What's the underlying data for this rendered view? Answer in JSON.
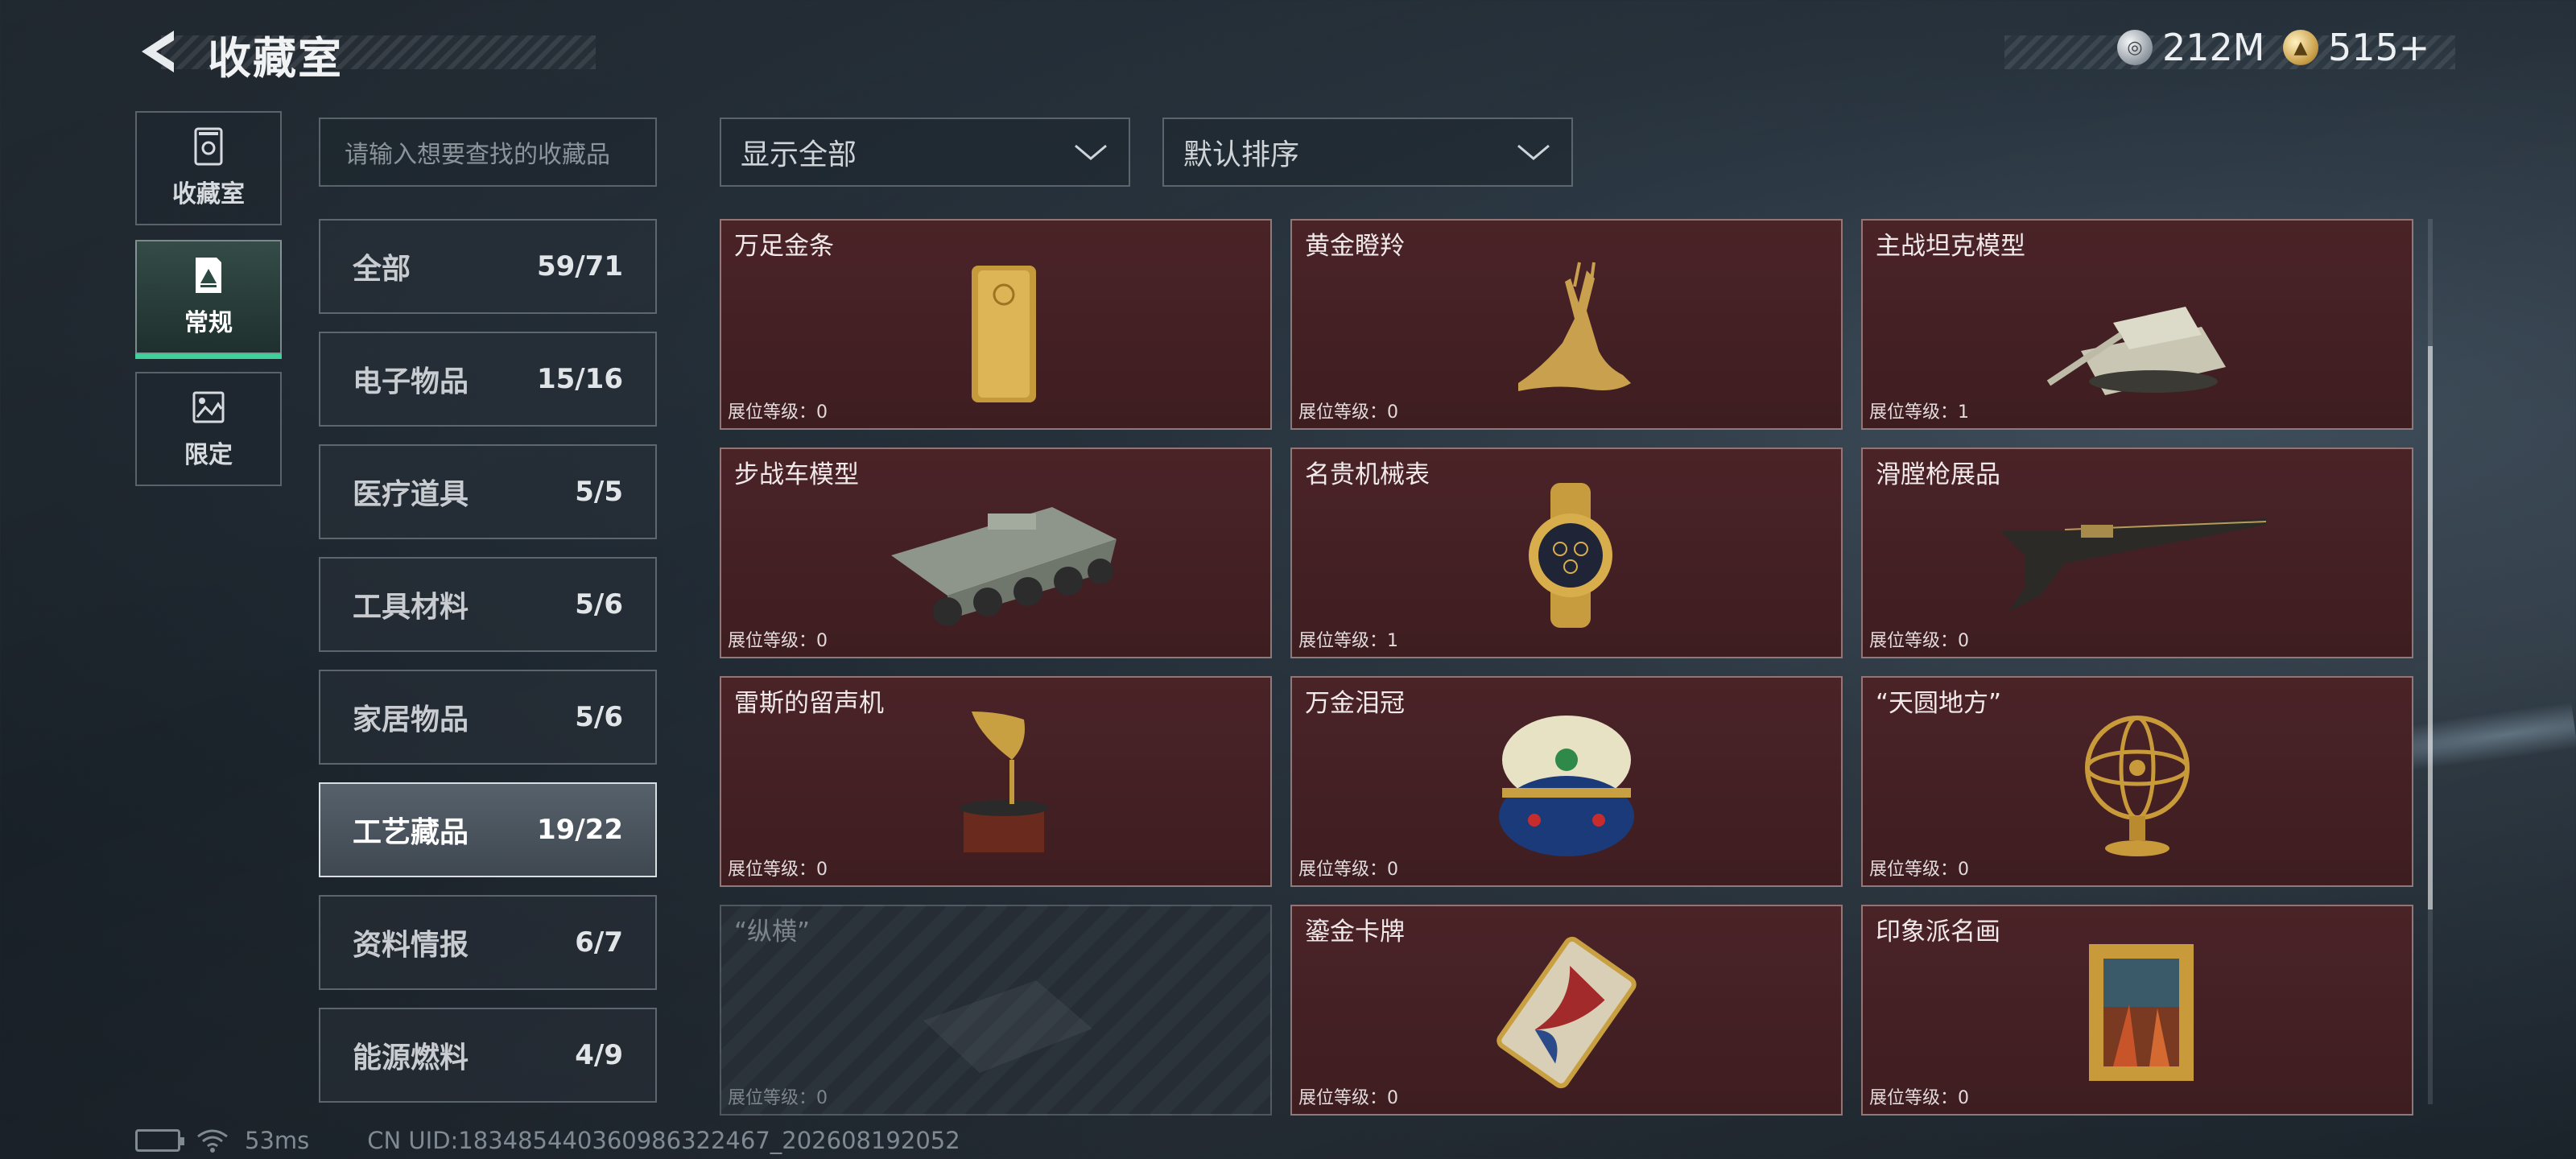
{
  "header": {
    "title": "收藏室",
    "currencies": [
      {
        "icon": "silver-coin-icon",
        "value": "212M"
      },
      {
        "icon": "gold-coin-icon",
        "value": "515+"
      }
    ]
  },
  "nav": {
    "items": [
      {
        "label": "收藏室",
        "icon": "trophy-case-icon",
        "active": false
      },
      {
        "label": "常规",
        "icon": "display-frame-icon",
        "active": true
      },
      {
        "label": "限定",
        "icon": "limited-picture-icon",
        "active": false
      }
    ]
  },
  "search": {
    "placeholder": "请输入想要查找的收藏品"
  },
  "categories": [
    {
      "name": "全部",
      "count": "59/71"
    },
    {
      "name": "电子物品",
      "count": "15/16"
    },
    {
      "name": "医疗道具",
      "count": "5/5"
    },
    {
      "name": "工具材料",
      "count": "5/6"
    },
    {
      "name": "家居物品",
      "count": "5/6"
    },
    {
      "name": "工艺藏品",
      "count": "19/22",
      "selected": true
    },
    {
      "name": "资料情报",
      "count": "6/7"
    },
    {
      "name": "能源燃料",
      "count": "4/9"
    }
  ],
  "filters": {
    "show": "显示全部",
    "sort": "默认排序"
  },
  "level_label": "展位等级：",
  "items": [
    {
      "name": "万足金条",
      "level": "0",
      "icon": "gold-bar-icon"
    },
    {
      "name": "黄金瞪羚",
      "level": "0",
      "icon": "golden-gazelle-icon"
    },
    {
      "name": "主战坦克模型",
      "level": "1",
      "icon": "tank-model-icon"
    },
    {
      "name": "步战车模型",
      "level": "0",
      "icon": "ifv-model-icon"
    },
    {
      "name": "名贵机械表",
      "level": "1",
      "icon": "watch-icon"
    },
    {
      "name": "滑膛枪展品",
      "level": "0",
      "icon": "musket-icon"
    },
    {
      "name": "雷斯的留声机",
      "level": "0",
      "icon": "gramophone-icon"
    },
    {
      "name": "万金泪冠",
      "level": "0",
      "icon": "jeweled-egg-icon"
    },
    {
      "name": "“天圆地方”",
      "level": "0",
      "icon": "armillary-sphere-icon"
    },
    {
      "name": "“纵横”",
      "level": "0",
      "icon": "chessboard-icon",
      "locked": true
    },
    {
      "name": "鎏金卡牌",
      "level": "0",
      "icon": "gilded-card-icon"
    },
    {
      "name": "印象派名画",
      "level": "0",
      "icon": "framed-painting-icon"
    }
  ],
  "footer": {
    "ping": "53ms",
    "uid": "CN UID:18348544036098632246​7_202608192052"
  }
}
